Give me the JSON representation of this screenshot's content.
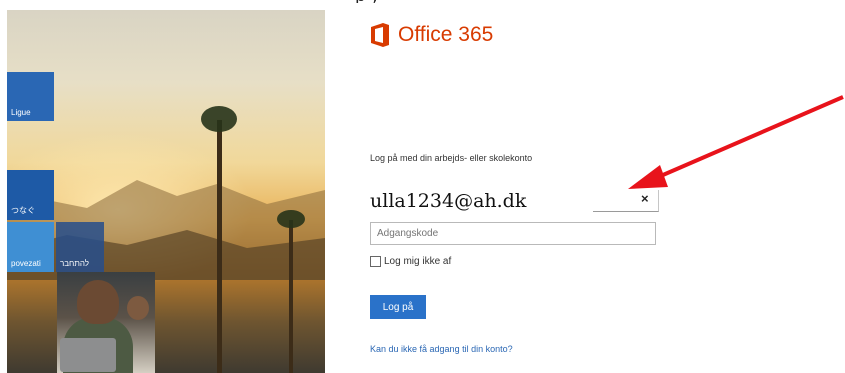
{
  "top_strip": "p                                                                              ,",
  "logo": {
    "text": "Office 365"
  },
  "login": {
    "prompt": "Log på med din arbejds- eller skolekonto",
    "username_value": "ulla1234@ah.dk",
    "clear_glyph": "×",
    "password_placeholder": "Adgangskode",
    "stay_signed_in_label": "Log mig ikke af",
    "signin_label": "Log på",
    "help_link": "Kan du ikke få adgang til din konto?"
  },
  "tiles": {
    "ligue": "Ligue",
    "tsunagu": "つなぐ",
    "povezati": "povezati",
    "hebrew": "להתחבר"
  },
  "colors": {
    "brand_orange": "#d83b01",
    "tile_blue": "#2a67b4",
    "button_blue": "#2a72c9",
    "arrow_red": "#e8131b"
  }
}
